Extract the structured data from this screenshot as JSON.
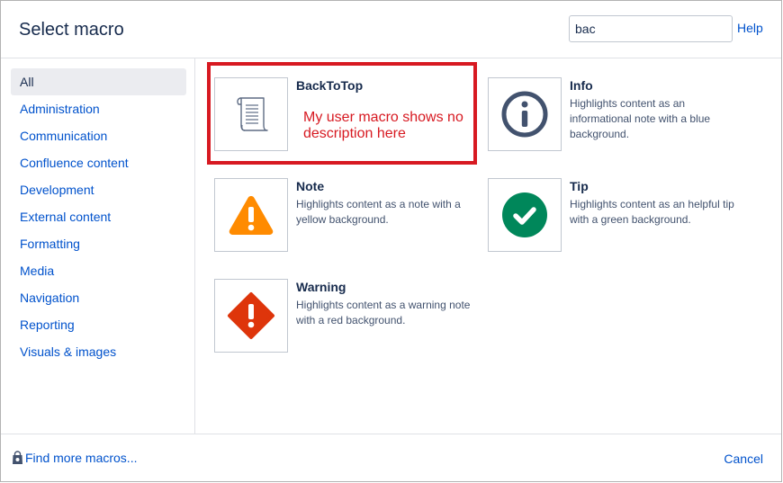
{
  "dialog": {
    "title": "Select macro",
    "search": {
      "value": "bac",
      "placeholder": ""
    },
    "help_label": "Help"
  },
  "sidebar": {
    "items": [
      {
        "label": "All",
        "active": true
      },
      {
        "label": "Administration"
      },
      {
        "label": "Communication"
      },
      {
        "label": "Confluence content"
      },
      {
        "label": "Development"
      },
      {
        "label": "External content"
      },
      {
        "label": "Formatting"
      },
      {
        "label": "Media"
      },
      {
        "label": "Navigation"
      },
      {
        "label": "Reporting"
      },
      {
        "label": "Visuals & images"
      }
    ]
  },
  "macros": [
    {
      "title": "BackToTop",
      "description": "",
      "icon": "scroll-icon"
    },
    {
      "title": "Info",
      "description": "Highlights content as an informational note with a blue background.",
      "icon": "info-icon",
      "color": "#42526e"
    },
    {
      "title": "Note",
      "description": "Highlights content as a note with a yellow background.",
      "icon": "warning-triangle-icon",
      "color": "#ff8b00"
    },
    {
      "title": "Tip",
      "description": "Highlights content as an helpful tip with a green background.",
      "icon": "check-circle-icon",
      "color": "#00875a"
    },
    {
      "title": "Warning",
      "description": "Highlights content as a warning note with a red background.",
      "icon": "error-diamond-icon",
      "color": "#de350b"
    }
  ],
  "annotation": {
    "text": "My user macro shows no description here",
    "color": "#d71921"
  },
  "footer": {
    "find_more_label": "Find more macros...",
    "find_more_icon": "shopping-bag-icon",
    "cancel_label": "Cancel"
  }
}
